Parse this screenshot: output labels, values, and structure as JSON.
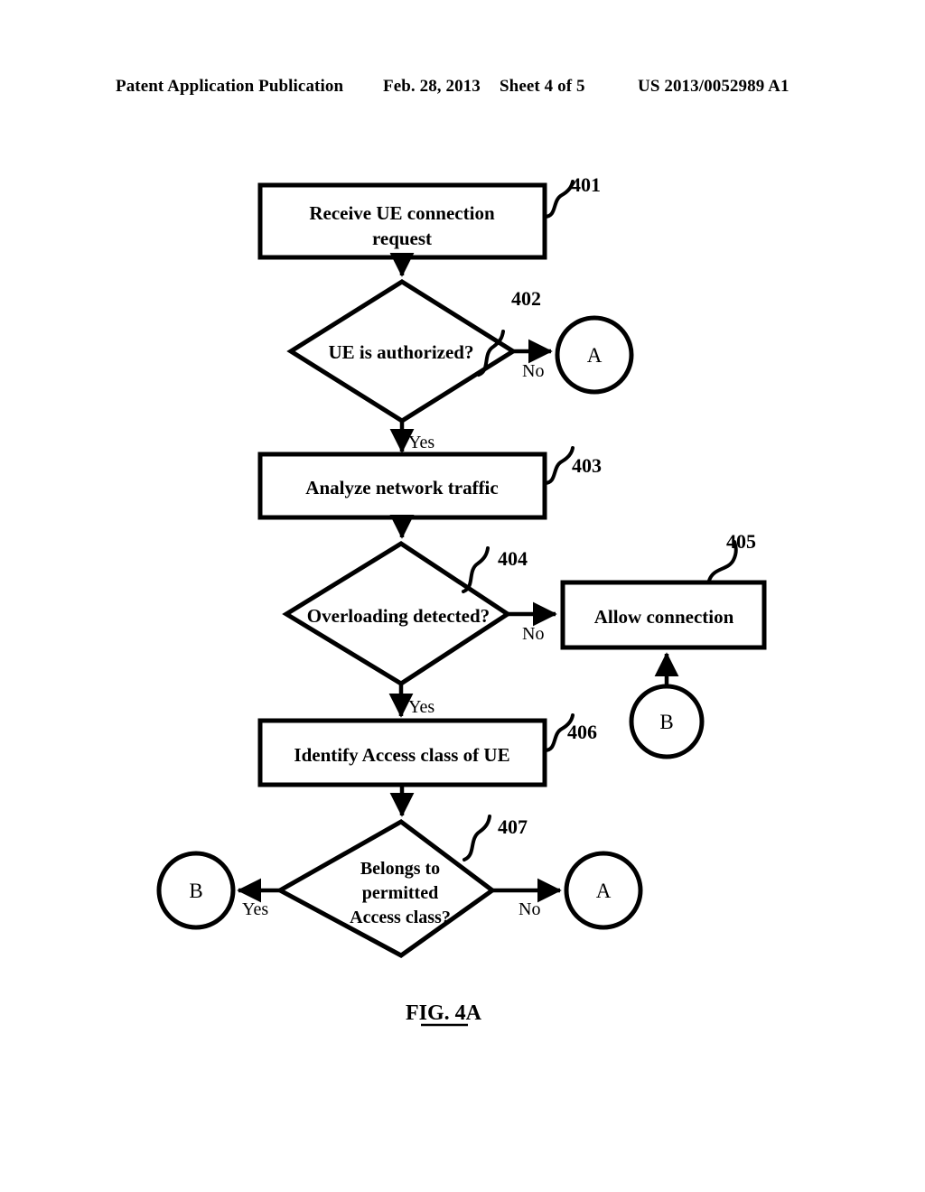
{
  "header": {
    "publication": "Patent Application Publication",
    "date": "Feb. 28, 2013",
    "sheet": "Sheet 4 of 5",
    "number": "US 2013/0052989 A1"
  },
  "figure": {
    "caption": "FIG. 4A",
    "nodes": {
      "n401": {
        "ref": "401",
        "line1": "Receive UE connection",
        "line2": "request"
      },
      "n402": {
        "ref": "402",
        "text": "UE is authorized?"
      },
      "n403": {
        "ref": "403",
        "text": "Analyze network traffic"
      },
      "n404": {
        "ref": "404",
        "text": "Overloading detected?"
      },
      "n405": {
        "ref": "405",
        "text": "Allow connection"
      },
      "n406": {
        "ref": "406",
        "text": "Identify Access class of UE"
      },
      "n407": {
        "ref": "407",
        "line1": "Belongs to",
        "line2": "permitted",
        "line3": "Access class?"
      }
    },
    "connectors": {
      "a_top": "A",
      "b_mid": "B",
      "b_bottom_left": "B",
      "a_bottom_right": "A"
    },
    "edge_labels": {
      "e402_no": "No",
      "e402_yes": "Yes",
      "e404_no": "No",
      "e404_yes": "Yes",
      "e407_yes": "Yes",
      "e407_no": "No"
    }
  }
}
